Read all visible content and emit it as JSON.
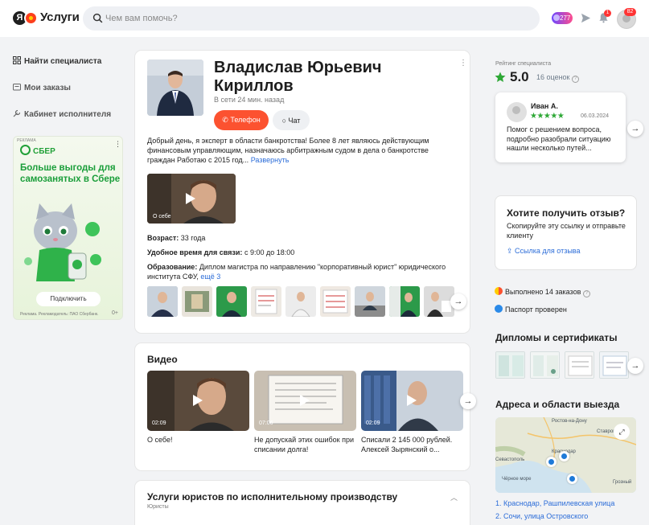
{
  "header": {
    "logo_letter": "Я",
    "logo_text": "Услуги",
    "search_placeholder": "Чем вам помочь?",
    "coins": "277",
    "notifications_count": "1",
    "profile_badge": "82"
  },
  "sidebar": {
    "items": [
      {
        "label": "Найти специалиста"
      },
      {
        "label": "Мои заказы"
      },
      {
        "label": "Кабинет исполнителя"
      }
    ]
  },
  "ad": {
    "label": "РЕКЛАМА",
    "brand": "СБЕР",
    "title": "Больше выгоды для самозанятых в Сбере",
    "button": "Подключить",
    "footer": "Реклама. Рекламодатель: ПАО Сбербанк.",
    "age": "0+"
  },
  "profile": {
    "name": "Владислав Юрьевич Кириллов",
    "online": "В сети 24 мин. назад",
    "phone_button": "Телефон",
    "chat_button": "Чат",
    "about": "Добрый день, я эксперт в области банкротства! Более 8 лет являюсь действующим финансовым управляющим, назначаюсь арбитражным судом в дела о банкротстве граждан Работаю с 2015 год...",
    "about_more": "Развернуть",
    "video_caption": "О себе",
    "age_label": "Возраст:",
    "age_value": "33 года",
    "time_label": "Удобное время для связи:",
    "time_value": "с 9:00 до 18:00",
    "edu_label": "Образование:",
    "edu_value": "Диплом магистра по направлению \"корпоративный юрист\" юридического института СФУ,",
    "edu_more": "ещё 3"
  },
  "videos": {
    "title": "Видео",
    "items": [
      {
        "duration": "02:09",
        "title": "О себе!"
      },
      {
        "duration": "07:06",
        "title": "Не допускай этих ошибок при списании долга!"
      },
      {
        "duration": "02:09",
        "title": "Списали 2 145 000 рублей. Алексей Зырянский о..."
      }
    ]
  },
  "services": {
    "title": "Услуги юристов по исполнительному производству",
    "subtitle": "Юристы"
  },
  "rating": {
    "label": "Рейтинг специалиста",
    "value": "5.0",
    "count": "16 оценок",
    "review": {
      "author": "Иван А.",
      "stars": "★★★★★",
      "date": "06.03.2024",
      "text": "Помог с решением вопроса, подробно разобрали ситуацию нашли несколько путей..."
    }
  },
  "feedback": {
    "title": "Хотите получить отзыв?",
    "text": "Скопируйте эту ссылку и отправьте клиенту",
    "link": "Ссылка для отзыва"
  },
  "stats": {
    "orders": "Выполнено 14 заказов",
    "passport": "Паспорт проверен"
  },
  "certificates": {
    "title": "Дипломы и сертификаты"
  },
  "addresses": {
    "title": "Адреса и области выезда",
    "map_labels": [
      "Ростов-на-Дону",
      "Краснодар",
      "Ставрополь",
      "Севастополь",
      "Чёрное море",
      "Грозный"
    ],
    "items": [
      "1. Краснодар, Рашпилевская улица",
      "2. Сочи, улица Островского"
    ]
  },
  "colors": {
    "accent_orange": "#fc5230",
    "link_blue": "#2b6cd8",
    "star_green": "#2ea836",
    "sber_green": "#21a038"
  }
}
